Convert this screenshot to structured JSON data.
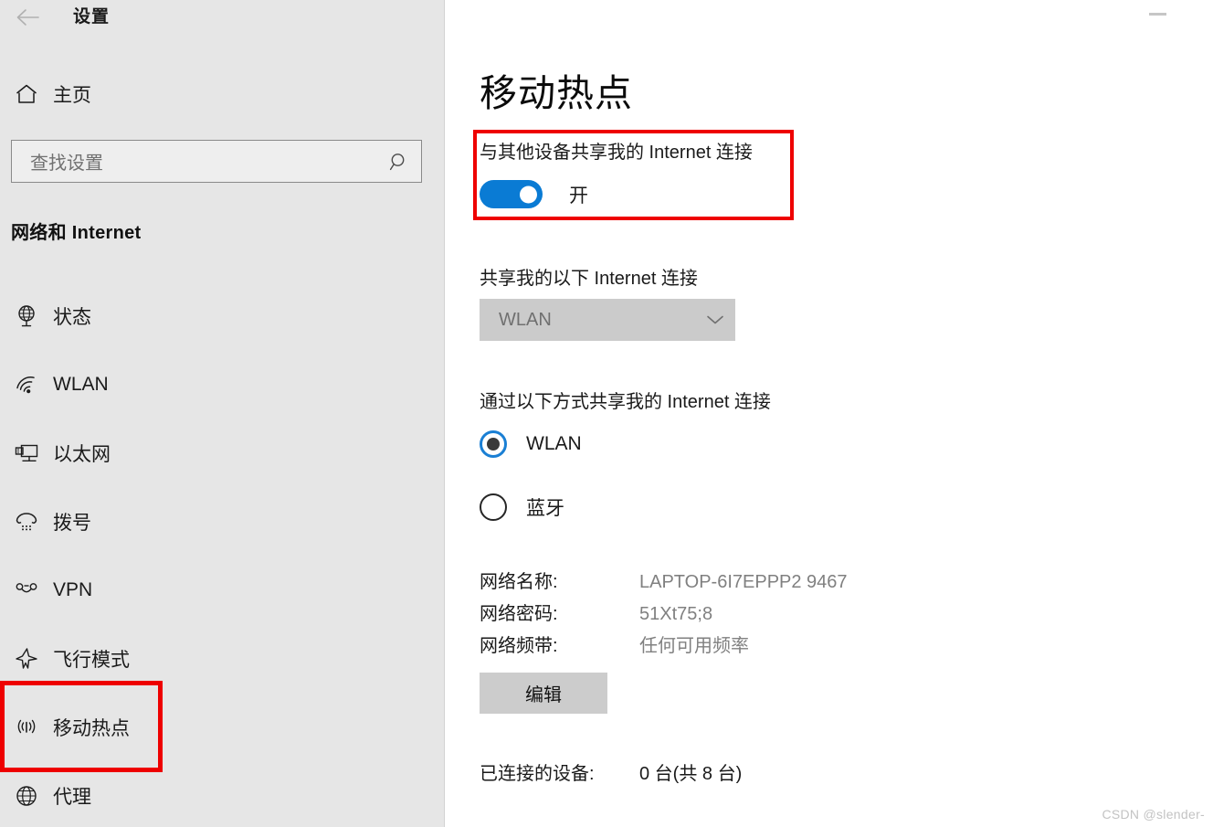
{
  "window": {
    "app_title": "设置",
    "back_icon": "back-arrow-icon",
    "minimize_icon": "minimize-icon",
    "watermark": "CSDN @slender-"
  },
  "sidebar": {
    "home": {
      "label": "主页",
      "icon": "home-icon"
    },
    "search": {
      "placeholder": "查找设置",
      "value": "",
      "icon": "search-icon"
    },
    "section_heading": "网络和 Internet",
    "items": [
      {
        "label": "状态",
        "icon": "globe-status-icon",
        "selected": false
      },
      {
        "label": "WLAN",
        "icon": "wifi-icon",
        "selected": false
      },
      {
        "label": "以太网",
        "icon": "ethernet-icon",
        "selected": false
      },
      {
        "label": "拨号",
        "icon": "dialup-phone-icon",
        "selected": false
      },
      {
        "label": "VPN",
        "icon": "vpn-icon",
        "selected": false
      },
      {
        "label": "飞行模式",
        "icon": "airplane-icon",
        "selected": false
      },
      {
        "label": "移动热点",
        "icon": "hotspot-icon",
        "selected": true
      },
      {
        "label": "代理",
        "icon": "proxy-globe-icon",
        "selected": false
      }
    ]
  },
  "main": {
    "page_title": "移动热点",
    "share_section": {
      "label": "与其他设备共享我的 Internet 连接",
      "toggle_state_label": "开",
      "toggle_on": true
    },
    "share_from": {
      "label": "共享我的以下 Internet 连接",
      "selected_value": "WLAN",
      "disabled": true,
      "chevron_icon": "chevron-down-icon"
    },
    "share_over": {
      "label": "通过以下方式共享我的 Internet 连接",
      "options": [
        {
          "label": "WLAN",
          "checked": true
        },
        {
          "label": "蓝牙",
          "checked": false
        }
      ]
    },
    "network_info": [
      {
        "key": "网络名称:",
        "value": "LAPTOP-6I7EPPP2 9467"
      },
      {
        "key": "网络密码:",
        "value": "51Xt75;8"
      },
      {
        "key": "网络频带:",
        "value": "任何可用频率"
      }
    ],
    "edit_button_label": "编辑",
    "connected_devices": {
      "key": "已连接的设备:",
      "value": "0 台(共 8 台)"
    }
  },
  "annotations": {
    "accent_red": "#ee0000",
    "toggle_accent_blue": "#0a7bd4"
  }
}
